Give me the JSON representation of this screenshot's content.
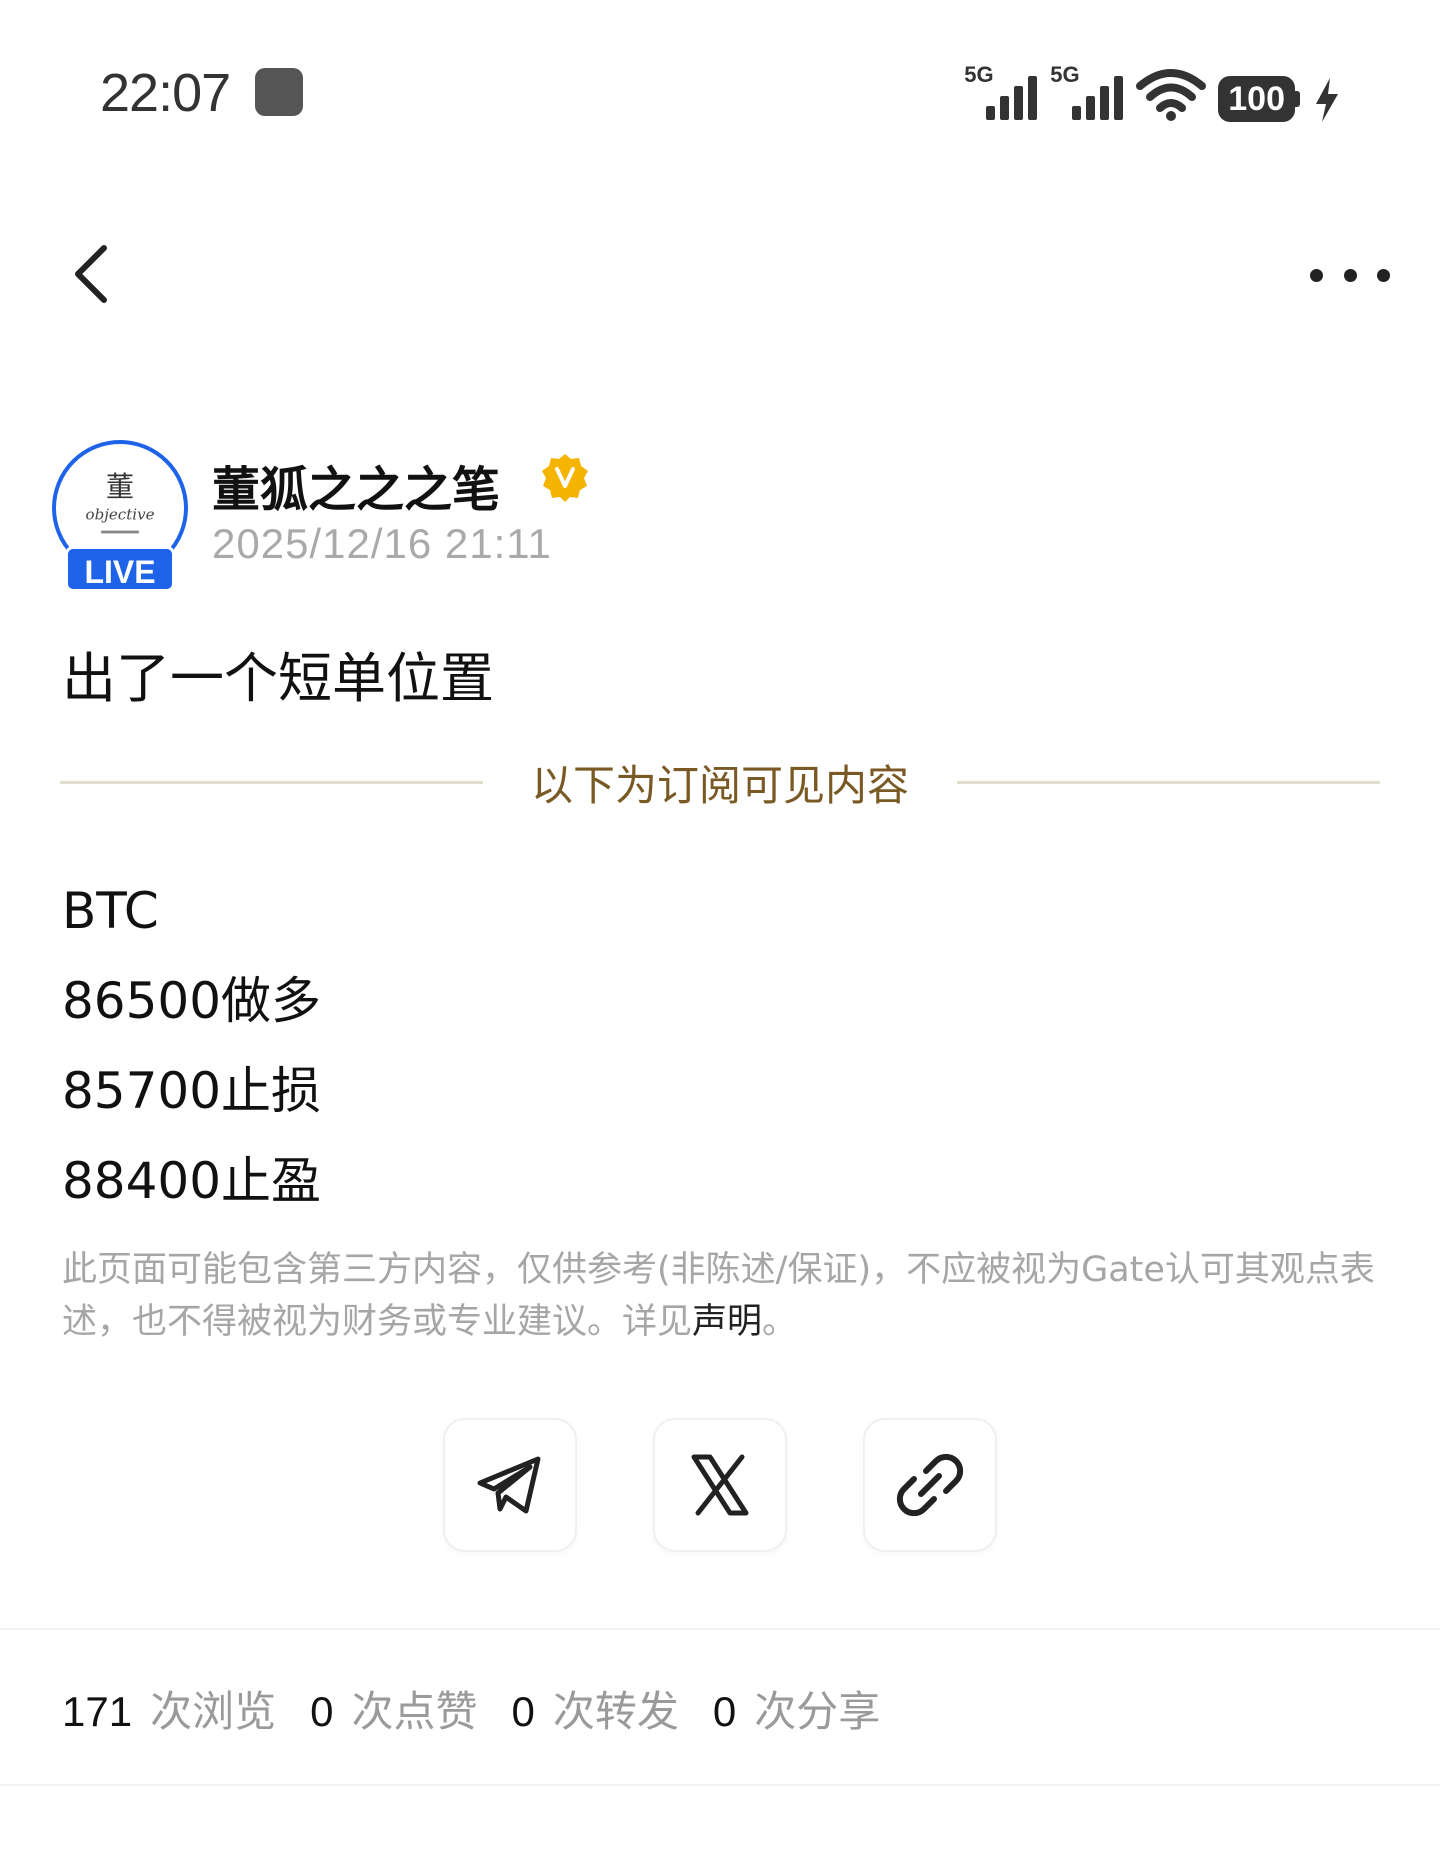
{
  "status_bar": {
    "time": "22:07",
    "sim1_label": "5G",
    "sim2_label": "5G",
    "battery": "100"
  },
  "nav": {
    "back_icon": "chevron-left-icon",
    "more_icon": "ellipsis-icon"
  },
  "author": {
    "name": "董狐之之之笔",
    "live_badge": "LIVE",
    "verified_icon": "verified-v-badge",
    "avatar_text": "objective",
    "post_time": "2025/12/16 21:11"
  },
  "post": {
    "title": "出了一个短单位置",
    "subscription_divider": "以下为订阅可见内容",
    "lines": [
      "BTC",
      "86500做多",
      "85700止损",
      "88400止盈"
    ]
  },
  "disclaimer": {
    "text": "此页面可能包含第三方内容，仅供参考(非陈述/保证)，不应被视为Gate认可其观点表述，也不得被视为财务或专业建议。详见",
    "link": "声明",
    "end": "。"
  },
  "share": [
    {
      "name": "telegram",
      "icon": "telegram-icon"
    },
    {
      "name": "x",
      "icon": "x-logo-icon"
    },
    {
      "name": "copy-link",
      "icon": "link-icon"
    }
  ],
  "stats": {
    "views": "171",
    "views_label": "次浏览",
    "likes": "0",
    "likes_label": "次点赞",
    "reposts": "0",
    "reposts_label": "次转发",
    "shares": "0",
    "shares_label": "次分享"
  },
  "colors": {
    "accent_blue": "#1e63e8",
    "verified_gold": "#f5b400",
    "divider_text": "#7a5a24",
    "muted_text": "#a6a6a6"
  }
}
